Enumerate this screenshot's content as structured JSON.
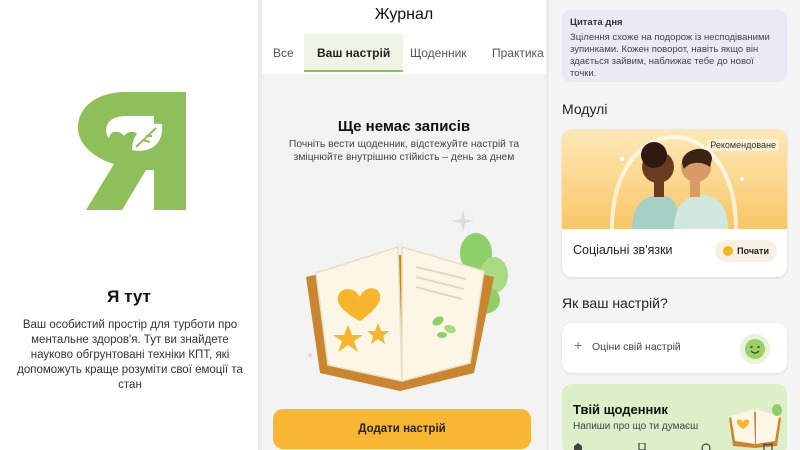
{
  "splash": {
    "title": "Я тут",
    "body": "Ваш особистий простір для турботи про ментальне здоров'я. Тут ви знайдете науково обгрунтовані техніки КПТ, які допоможуть краще розуміти свої емоції та стан"
  },
  "journal": {
    "title": "Журнал",
    "tabs": [
      {
        "label": "Все"
      },
      {
        "label": "Ваш настрій"
      },
      {
        "label": "Щоденник"
      },
      {
        "label": "Практика"
      }
    ],
    "active_tab": "Ваш настрій",
    "empty_title": "Ще немає записів",
    "empty_text": "Почніть вести щоденник, відстежуйте настрій та зміцнюйте внутрішню стійкість – день за днем",
    "add_button": "Додати настрій"
  },
  "home": {
    "quote_title": "Цитата дня",
    "quote_text": "Зцілення схоже на подорож із несподіваними зупинками. Кожен поворот, навіть якщо він здається зайвим, наближає тебе до нової точки.",
    "modules_title": "Модулі",
    "module_badge": "Рекомендоване",
    "module_name": "Соціальні зв'язки",
    "start_button": "Почати",
    "mood_title": "Як ваш настрій?",
    "mood_prompt": "Оціни свій настрій",
    "diary_title": "Твій щоденник",
    "diary_subtitle": "Напиши про що ти думаєш"
  },
  "colors": {
    "brand_green": "#8fbf5a",
    "accent_yellow": "#f7b733",
    "quote_bg": "#eaeaf7",
    "diary_bg": "#dcefc8"
  }
}
